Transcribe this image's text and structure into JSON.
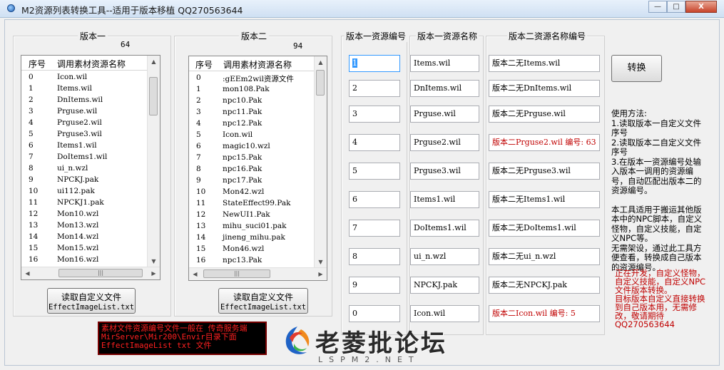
{
  "window": {
    "title": "M2资源列表转换工具--适用于版本移植 QQ270563644",
    "minimize": "—",
    "maximize": "□",
    "close": "X"
  },
  "version1": {
    "title": "版本一",
    "count": "64",
    "col_index": "序号",
    "col_name": "调用素材资源名称",
    "rows": [
      {
        "n": "0",
        "name": "Icon.wil"
      },
      {
        "n": "1",
        "name": "Items.wil"
      },
      {
        "n": "2",
        "name": "DnItems.wil"
      },
      {
        "n": "3",
        "name": "Prguse.wil"
      },
      {
        "n": "4",
        "name": "Prguse2.wil"
      },
      {
        "n": "5",
        "name": "Prguse3.wil"
      },
      {
        "n": "6",
        "name": "Items1.wil"
      },
      {
        "n": "7",
        "name": "DoItems1.wil"
      },
      {
        "n": "8",
        "name": "ui_n.wzl"
      },
      {
        "n": "9",
        "name": "NPCKJ.pak"
      },
      {
        "n": "10",
        "name": "ui112.pak"
      },
      {
        "n": "11",
        "name": "NPCKJ1.pak"
      },
      {
        "n": "12",
        "name": "Mon10.wzl"
      },
      {
        "n": "13",
        "name": "Mon13.wzl"
      },
      {
        "n": "14",
        "name": "Mon14.wzl"
      },
      {
        "n": "15",
        "name": "Mon15.wzl"
      },
      {
        "n": "16",
        "name": "Mon16.wzl"
      }
    ],
    "load_button_line1": "读取自定义文件",
    "load_button_line2": "EffectImageList.txt"
  },
  "version2": {
    "title": "版本二",
    "count": "94",
    "col_index": "序号",
    "col_name": "调用素材资源名称",
    "rows": [
      {
        "n": "0",
        "name": ":gEEm2wil资源文件"
      },
      {
        "n": "1",
        "name": "mon108.Pak"
      },
      {
        "n": "2",
        "name": "npc10.Pak"
      },
      {
        "n": "3",
        "name": "npc11.Pak"
      },
      {
        "n": "4",
        "name": "npc12.Pak"
      },
      {
        "n": "5",
        "name": "Icon.wil"
      },
      {
        "n": "6",
        "name": "magic10.wzl"
      },
      {
        "n": "7",
        "name": "npc15.Pak"
      },
      {
        "n": "8",
        "name": "npc16.Pak"
      },
      {
        "n": "9",
        "name": "npc17.Pak"
      },
      {
        "n": "10",
        "name": "Mon42.wzl"
      },
      {
        "n": "11",
        "name": "StateEffect99.Pak"
      },
      {
        "n": "12",
        "name": "NewUI1.Pak"
      },
      {
        "n": "13",
        "name": "mihu_suci01.pak"
      },
      {
        "n": "14",
        "name": "jineng_mihu.pak"
      },
      {
        "n": "15",
        "name": "Mon46.wzl"
      },
      {
        "n": "16",
        "name": "npc13.Pak"
      }
    ],
    "load_button_line1": "读取自定义文件",
    "load_button_line2": "EffectImageList.txt"
  },
  "mapping": {
    "col1_title": "版本一资源编号",
    "col2_title": "版本一资源名称",
    "col3_title": "版本二资源名称编号",
    "rows": [
      {
        "id": "1",
        "name": "Items.wil",
        "result": "版本二无Items.wil",
        "red": false
      },
      {
        "id": "2",
        "name": "DnItems.wil",
        "result": "版本二无DnItems.wil",
        "red": false
      },
      {
        "id": "3",
        "name": "Prguse.wil",
        "result": "版本二无Prguse.wil",
        "red": false
      },
      {
        "id": "4",
        "name": "Prguse2.wil",
        "result": "版本二Prguse2.wil 编号: 63",
        "red": true
      },
      {
        "id": "5",
        "name": "Prguse3.wil",
        "result": "版本二无Prguse3.wil",
        "red": false
      },
      {
        "id": "6",
        "name": "Items1.wil",
        "result": "版本二无Items1.wil",
        "red": false
      },
      {
        "id": "7",
        "name": "DoItems1.wil",
        "result": "版本二无DoItems1.wil",
        "red": false
      },
      {
        "id": "8",
        "name": "ui_n.wzl",
        "result": "版本二无ui_n.wzl",
        "red": false
      },
      {
        "id": "9",
        "name": "NPCKJ.pak",
        "result": "版本二无NPCKJ.pak",
        "red": false
      },
      {
        "id": "0",
        "name": "Icon.wil",
        "result": "版本二Icon.wil 编号: 5",
        "red": true
      }
    ]
  },
  "convert_button": "转换",
  "help": {
    "lines": [
      "使用方法:",
      "1.读取版本一自定义文件序号",
      "2.读取版本二自定义文件序号",
      "3.在版本一资源编号处输入版本一调用的资源编号，自动匹配出版本二的资源编号。",
      "",
      "本工具适用于搬运其他版本中的NPC脚本，自定义怪物，自定义技能，自定义NPC等。",
      "无需架设，通过此工具方便查看，转换成自己版本的资源编号。"
    ]
  },
  "red_note": {
    "lines": [
      "正在开发，自定义怪物，自定义技能，自定义NPC文件版本转换。",
      "目标版本自定义直接转换到自己版本用，无需修改，敬请期待",
      "QQ270563644"
    ]
  },
  "notice_box": {
    "lines": [
      "素材文件资源编号文件一般在 传奇服务端",
      "MirServer\\Mir200\\Envir目录下面",
      "EffectImageList txt 文件"
    ]
  },
  "watermark": {
    "text": "老菱批论坛",
    "sub": "LSPM2.NET"
  },
  "colors": {
    "red_text": "#c00000",
    "notice_bg": "#000000",
    "notice_text": "#ff2020"
  }
}
